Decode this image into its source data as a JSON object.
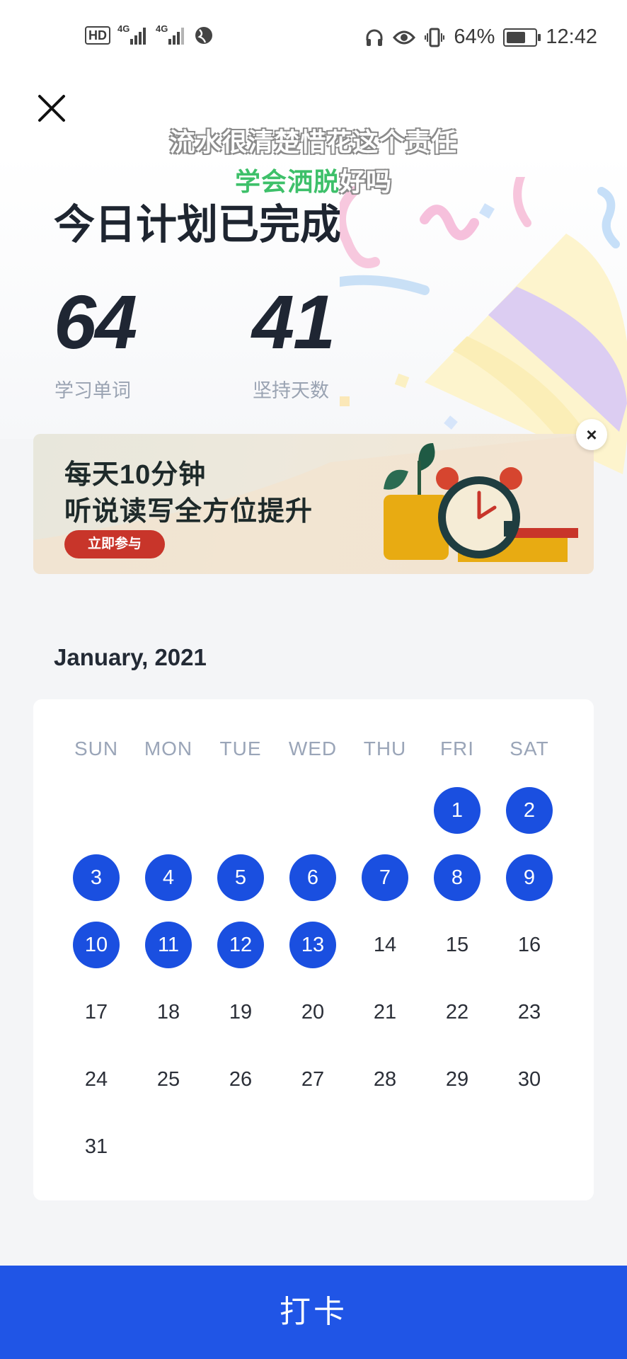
{
  "status_bar": {
    "hd_label": "HD",
    "net1": "4G",
    "net2": "4G",
    "battery_percent": "64%",
    "time": "12:42",
    "icons": [
      "headphones-icon",
      "eye-icon",
      "vibrate-icon",
      "battery-icon"
    ]
  },
  "lyrics": {
    "line1": "流水很清楚惜花这个责任",
    "line2_highlight": "学会洒脱",
    "line2_rest": "好吗"
  },
  "header": {
    "title": "今日计划已完成",
    "stats": [
      {
        "value": "64",
        "label": "学习单词"
      },
      {
        "value": "41",
        "label": "坚持天数"
      }
    ]
  },
  "banner": {
    "line1": "每天10分钟",
    "line2": "听说读写全方位提升",
    "cta": "立即参与",
    "close_label": "×"
  },
  "calendar": {
    "month_label": "January, 2021",
    "weekdays": [
      "SUN",
      "MON",
      "TUE",
      "WED",
      "THU",
      "FRI",
      "SAT"
    ],
    "first_weekday_index": 5,
    "days_in_month": 31,
    "completed_days": [
      1,
      2,
      3,
      4,
      5,
      6,
      7,
      8,
      9,
      10,
      11,
      12,
      13
    ],
    "accent_color": "#1a4fe0"
  },
  "footer": {
    "checkin_label": "打卡",
    "color": "#2055e6"
  }
}
